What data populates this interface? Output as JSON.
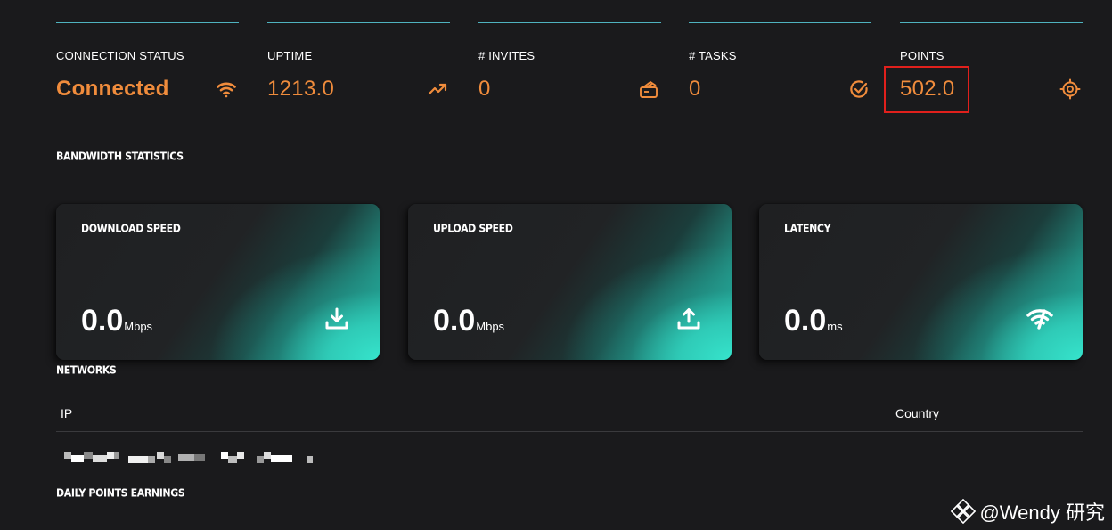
{
  "stats": [
    {
      "id": "connection-status",
      "label": "CONNECTION STATUS",
      "value": "Connected",
      "icon": "wifi-icon"
    },
    {
      "id": "uptime",
      "label": "UPTIME",
      "value": "1213.0",
      "icon": "trending-up-icon"
    },
    {
      "id": "invites",
      "label": "# INVITES",
      "value": "0",
      "icon": "stack-icon"
    },
    {
      "id": "tasks",
      "label": "# TASKS",
      "value": "0",
      "icon": "check-circle-icon"
    },
    {
      "id": "points",
      "label": "POINTS",
      "value": "502.0",
      "icon": "target-icon"
    }
  ],
  "bandwidth": {
    "title": "BANDWIDTH STATISTICS",
    "cards": [
      {
        "title": "DOWNLOAD SPEED",
        "value": "0.0",
        "unit": "Mbps",
        "icon": "download-icon"
      },
      {
        "title": "UPLOAD SPEED",
        "value": "0.0",
        "unit": "Mbps",
        "icon": "upload-icon"
      },
      {
        "title": "LATENCY",
        "value": "0.0",
        "unit": "ms",
        "icon": "signal-icon"
      }
    ]
  },
  "networks": {
    "title": "NETWORKS",
    "columns": [
      "IP",
      "Country"
    ]
  },
  "daily_points": {
    "title": "DAILY POINTS EARNINGS"
  },
  "watermark": {
    "text": "@Wendy 研究"
  },
  "colors": {
    "accent_orange": "#f08c3c",
    "accent_teal": "#36e4cc",
    "highlight_red": "#e0201c",
    "background": "#1a1a1c"
  }
}
